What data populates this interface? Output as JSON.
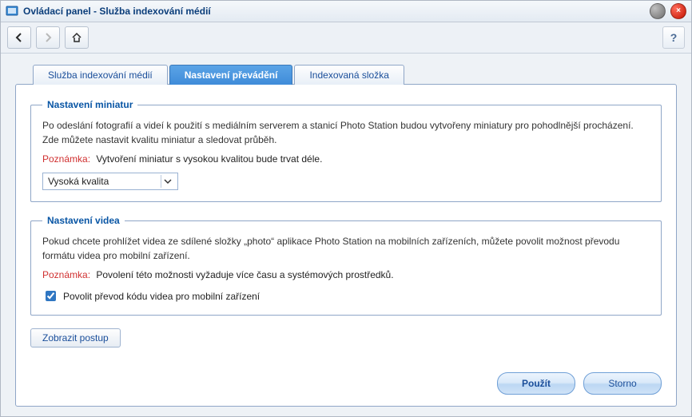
{
  "title": "Ovládací panel - Služba indexování médií",
  "tabs": {
    "service": "Služba indexování médií",
    "conversion": "Nastavení převádění",
    "folder": "Indexovaná složka"
  },
  "thumb": {
    "legend": "Nastavení miniatur",
    "body": "Po odeslání fotografií a videí k použití s mediálním serverem a stanicí Photo Station budou vytvořeny miniatury pro pohodlnější procházení. Zde můžete nastavit kvalitu miniatur a sledovat průběh.",
    "note_label": "Poznámka:",
    "note_text": "Vytvoření miniatur s vysokou kvalitou bude trvat déle.",
    "select_value": "Vysoká kvalita"
  },
  "video": {
    "legend": "Nastavení videa",
    "body": "Pokud chcete prohlížet videa ze sdílené složky „photo“ aplikace Photo Station na mobilních zařízeních, můžete povolit možnost převodu formátu videa pro mobilní zařízení.",
    "note_label": "Poznámka:",
    "note_text": "Povolení této možnosti vyžaduje více času a systémových prostředků.",
    "checkbox_label": "Povolit převod kódu videa pro mobilní zařízení",
    "checked": true
  },
  "progress_button": "Zobrazit postup",
  "buttons": {
    "apply": "Použít",
    "cancel": "Storno"
  },
  "help": "?"
}
